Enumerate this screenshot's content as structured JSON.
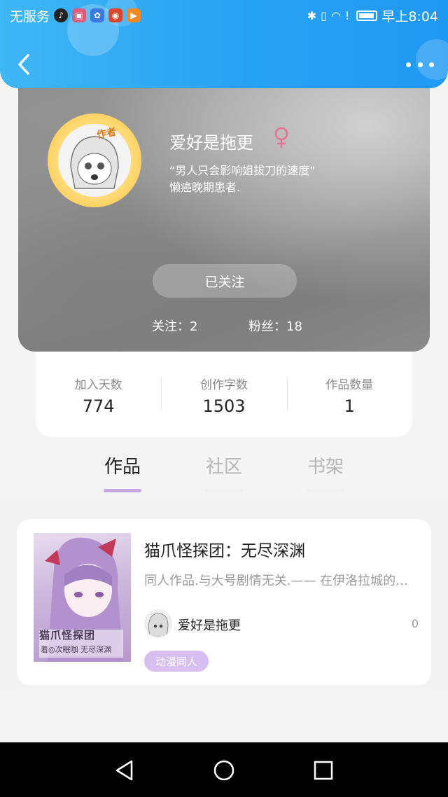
{
  "status_bar": {
    "carrier": "无服务",
    "time": "早上8:04"
  },
  "header": {
    "back_icon": "chevron-left-icon",
    "more_icon": "more-dots-icon"
  },
  "profile": {
    "author_tag": "作者",
    "username": "爱好是拖更",
    "gender_icon": "female-icon",
    "bio_line1": "“男人只会影响姐拔刀的速度”",
    "bio_line2": "懒癌晚期患者.",
    "follow_button": "已关注",
    "following": "关注：2",
    "fans": "粉丝：18"
  },
  "stats": [
    {
      "label": "加入天数",
      "value": "774"
    },
    {
      "label": "创作字数",
      "value": "1503"
    },
    {
      "label": "作品数量",
      "value": "1"
    }
  ],
  "tabs": [
    {
      "label": "作品",
      "active": true
    },
    {
      "label": "社区",
      "active": false
    },
    {
      "label": "书架",
      "active": false
    }
  ],
  "works": [
    {
      "cover_title": "猫爪怪探团",
      "cover_subtitle": "着◎次眠咖  无尽深渊",
      "title": "猫爪怪探团：无尽深渊",
      "description": "同人作品.与大号剧情无关.—— 在伊洛拉城的边缘，有一个神秘的地方",
      "author": "爱好是拖更",
      "count": "0",
      "tag": "动漫同人"
    }
  ],
  "colors": {
    "header_blue": "#27a2f3",
    "tab_accent": "#c9a8e8",
    "tag_purple": "#d7bdf0",
    "gender_pink": "#e6738f"
  }
}
